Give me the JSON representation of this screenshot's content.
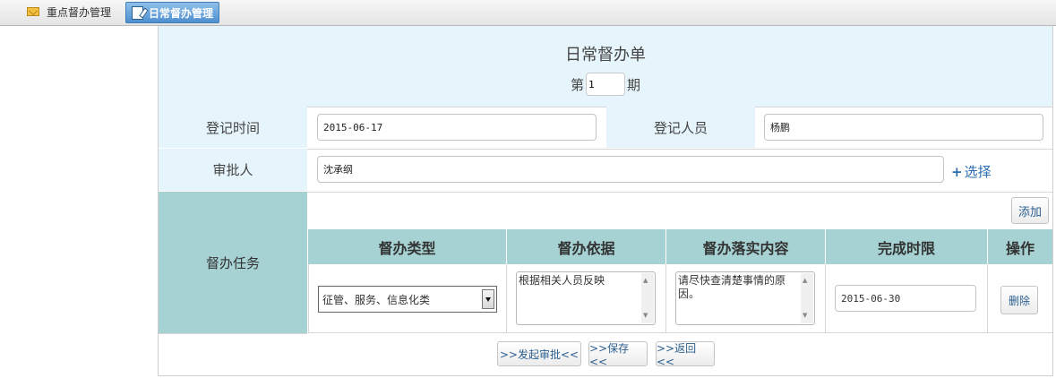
{
  "tabs": [
    {
      "label": "重点督办管理",
      "icon": "mail-icon",
      "active": false
    },
    {
      "label": "日常督办管理",
      "icon": "edit-icon",
      "active": true
    }
  ],
  "form": {
    "title": "日常督办单",
    "issue_prefix": "第",
    "issue_value": "1",
    "issue_suffix": "期",
    "register_time_label": "登记时间",
    "register_time_value": "2015-06-17",
    "registrar_label": "登记人员",
    "registrar_value": "杨鹏",
    "approver_label": "审批人",
    "approver_value": "沈承纲",
    "choose_label": "选择",
    "task_label": "督办任务",
    "add_label": "添加",
    "columns": [
      "督办类型",
      "督办依据",
      "督办落实内容",
      "完成时限",
      "操作"
    ],
    "row": {
      "type": "征管、服务、信息化类",
      "basis": "根据相关人员反映",
      "content": "请尽快查清楚事情的原因。",
      "deadline": "2015-06-30",
      "delete_label": "删除"
    },
    "buttons": {
      "submit": ">>发起审批<<",
      "save": ">>保存<<",
      "back": ">>返回<<"
    }
  },
  "colors": {
    "header_bg": "#e6f4fc",
    "task_bg": "#a6d2d3",
    "link": "#2b6db2"
  }
}
